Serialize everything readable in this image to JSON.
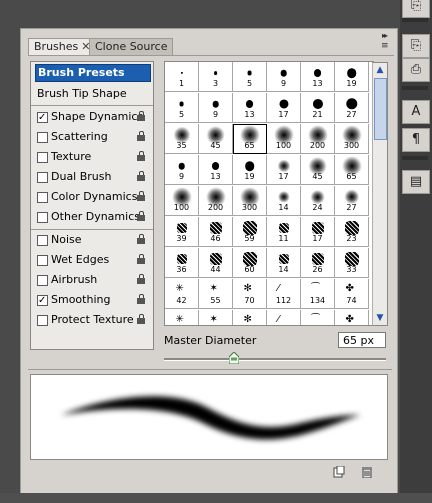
{
  "tabs": [
    {
      "label": "Brushes",
      "close": "✕",
      "active": true
    },
    {
      "label": "Clone Source",
      "active": false
    }
  ],
  "panel_menu": "▸▸",
  "options": {
    "header": "Brush Presets",
    "tip_shape": "Brush Tip Shape",
    "items": [
      {
        "label": "Shape Dynamics",
        "checked": true,
        "lock": true
      },
      {
        "label": "Scattering",
        "checked": false,
        "lock": true
      },
      {
        "label": "Texture",
        "checked": false,
        "lock": true
      },
      {
        "label": "Dual Brush",
        "checked": false,
        "lock": true
      },
      {
        "label": "Color Dynamics",
        "checked": false,
        "lock": true
      },
      {
        "label": "Other Dynamics",
        "checked": false,
        "lock": true
      },
      {
        "label": "Noise",
        "checked": false,
        "lock": true
      },
      {
        "label": "Wet Edges",
        "checked": false,
        "lock": true
      },
      {
        "label": "Airbrush",
        "checked": false,
        "lock": true
      },
      {
        "label": "Smoothing",
        "checked": true,
        "lock": true
      },
      {
        "label": "Protect Texture",
        "checked": false,
        "lock": true
      }
    ]
  },
  "presets": [
    [
      "1",
      "3",
      "5",
      "9",
      "13",
      "19"
    ],
    [
      "5",
      "9",
      "13",
      "17",
      "21",
      "27"
    ],
    [
      "35",
      "45",
      "65",
      "100",
      "200",
      "300"
    ],
    [
      "9",
      "13",
      "19",
      "17",
      "45",
      "65"
    ],
    [
      "100",
      "200",
      "300",
      "14",
      "24",
      "27"
    ],
    [
      "39",
      "46",
      "59",
      "11",
      "17",
      "23"
    ],
    [
      "36",
      "44",
      "60",
      "14",
      "26",
      "33"
    ],
    [
      "42",
      "55",
      "70",
      "112",
      "134",
      "74"
    ],
    [
      "",
      "",
      "",
      "",
      "",
      ""
    ]
  ],
  "selected_preset": "65",
  "master_diameter": {
    "label": "Master Diameter",
    "value": "65 px"
  },
  "dock": [
    "⎘",
    "⎙",
    "A",
    "¶",
    "▤"
  ]
}
